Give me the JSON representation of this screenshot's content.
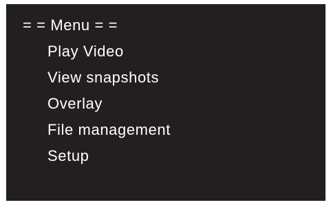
{
  "menu": {
    "title": "= = Menu = =",
    "items": [
      {
        "label": "Play Video"
      },
      {
        "label": "View snapshots"
      },
      {
        "label": "Overlay"
      },
      {
        "label": "File management"
      },
      {
        "label": "Setup"
      }
    ]
  },
  "colors": {
    "background": "#231f20",
    "text": "#ffffff"
  }
}
